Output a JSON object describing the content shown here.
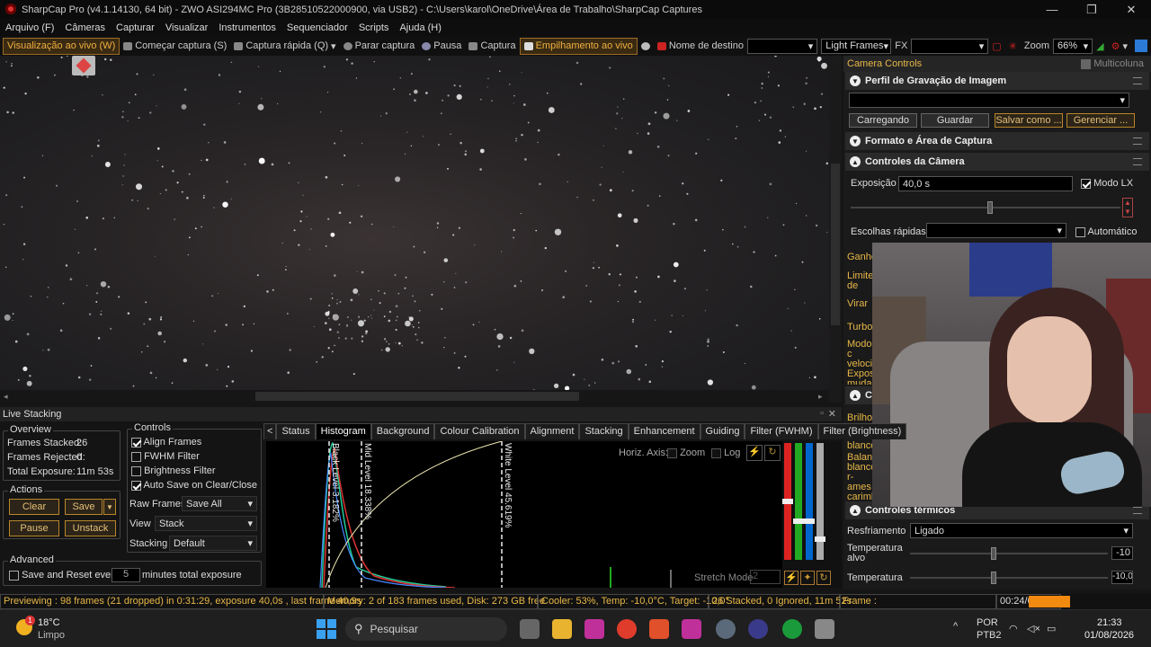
{
  "window": {
    "title": "SharpCap Pro (v4.1.14130, 64 bit) - ZWO ASI294MC Pro (3B28510522000900, via USB2) - C:\\Users\\karol\\OneDrive\\Área de Trabalho\\SharpCap Captures"
  },
  "menu": [
    "Arquivo (F)",
    "Câmeras",
    "Capturar",
    "Visualizar",
    "Instrumentos",
    "Sequenciador",
    "Scripts",
    "Ajuda (H)"
  ],
  "toolbar": {
    "live_view": "Visualização ao vivo (W)",
    "start_capture": "Começar captura (S)",
    "quick_capture": "Captura rápida (Q)",
    "stop_capture": "Parar captura",
    "pause": "Pausa",
    "capture": "Captura",
    "live_stack": "Empilhamento ao vivo",
    "target_label": "Nome de destino",
    "frame_type": "Light Frames",
    "fx": "FX",
    "zoom_label": "Zoom",
    "zoom_value": "66%"
  },
  "camera_panel": {
    "title": "Camera Controls",
    "multicolumn": "Multicoluna",
    "sec_profile": "Perfil de Gravação de Imagem",
    "btn_loading": "Carregando",
    "btn_save": "Guardar",
    "btn_save_as": "Salvar como ...",
    "btn_manage": "Gerenciar ...",
    "sec_format": "Formato e Área de Captura",
    "sec_camera": "Controles da Câmera",
    "exposure_label": "Exposição",
    "exposure_value": "40,0 s",
    "lx_mode": "Modo LX",
    "quick_choices": "Escolhas rápidas",
    "automatic": "Automático",
    "cut_labels": [
      "Ganho",
      "Limite de qua",
      "Virar",
      "Turbo",
      "Modo c velocid Expos mudan ganho"
    ],
    "sec_co": "Co",
    "cut_labels2": [
      "Brilho",
      "Balanç blanco",
      "Balanç blanco r-ames carimb data/h"
    ],
    "sec_thermal": "Controles térmicos",
    "cooling_label": "Resfriamento",
    "cooling_value": "Ligado",
    "target_temp_label": "Temperatura alvo",
    "target_temp_value": "-10",
    "temp_label": "Temperatura",
    "temp_value": "-10,0"
  },
  "live_stacking": {
    "title": "Live Stacking",
    "overview_title": "Overview",
    "frames_stacked_label": "Frames Stacked:",
    "frames_stacked": "26",
    "frames_rejected_label": "Frames Rejected:",
    "frames_rejected": "0",
    "total_exposure_label": "Total Exposure:",
    "total_exposure": "11m 53s",
    "actions_title": "Actions",
    "clear": "Clear",
    "save": "Save",
    "pause": "Pause",
    "unstack": "Unstack",
    "advanced_title": "Advanced",
    "save_reset": "Save and Reset every",
    "save_reset_value": "5",
    "save_reset_unit": "minutes total exposure",
    "controls_title": "Controls",
    "align": "Align Frames",
    "fwhm": "FWHM Filter",
    "brightness": "Brightness Filter",
    "autosave": "Auto Save on Clear/Close",
    "raw_frames_label": "Raw Frames",
    "raw_frames_value": "Save All",
    "view_label": "View",
    "view_value": "Stack",
    "stacking_label": "Stacking",
    "stacking_value": "Default",
    "tabs": [
      "Status",
      "Histogram",
      "Background",
      "Colour Calibration",
      "Alignment",
      "Stacking",
      "Enhancement",
      "Guiding",
      "Filter (FWHM)",
      "Filter (Brightness)"
    ],
    "horiz_axis": "Horiz. Axis:",
    "zoom": "Zoom",
    "log": "Log",
    "black_level": "Black Level 3.182%",
    "mid_level": "Mid Level 18.338%",
    "white_level": "White Level 45.619%",
    "stretch_mode": "Stretch Mode",
    "stretch_value": "2"
  },
  "status": {
    "preview": "Previewing : 98 frames (21 dropped) in 0:31:29, exposure 40,0s , last frame 40,9s",
    "memory": "Memory: 2 of 183 frames used, Disk: 273 GB free",
    "cooler": "Cooler: 53%, Temp: -10,0°C, Target: -10,0°",
    "stacked": "26 Stacked, 0 Ignored, 11m 52s",
    "frame": "Frame :",
    "time": "00:24/00:16"
  },
  "taskbar": {
    "temp": "18°C",
    "weather": "Limpo",
    "search": "Pesquisar",
    "lang1": "POR",
    "lang2": "PTB2",
    "clock": "21:33",
    "date": "01/08/2026",
    "weather_badge": "1"
  }
}
